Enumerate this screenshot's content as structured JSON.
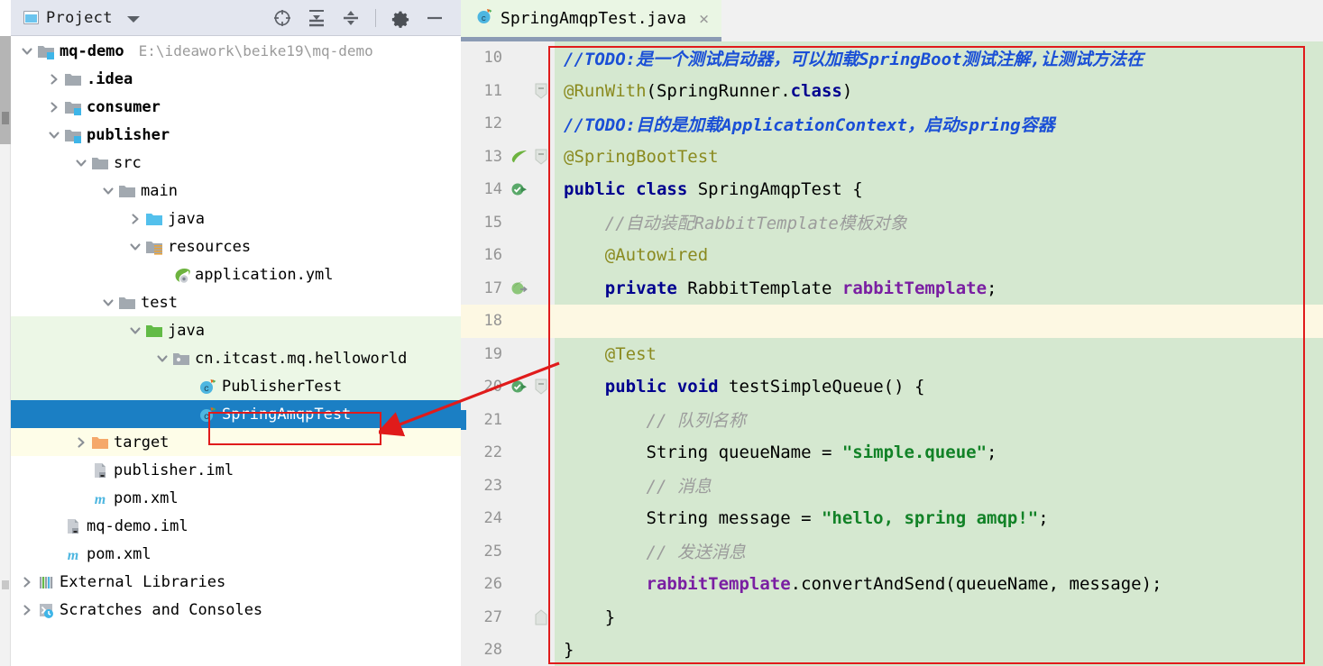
{
  "tool_window": {
    "title": "Project",
    "icons": [
      {
        "name": "locate-icon",
        "glyph": "crosshair"
      },
      {
        "name": "expand-all-icon",
        "glyph": "expand"
      },
      {
        "name": "collapse-all-icon",
        "glyph": "collapse"
      },
      {
        "name": "settings-gear-icon",
        "glyph": "gear"
      },
      {
        "name": "minimize-icon",
        "glyph": "minus"
      }
    ]
  },
  "tree": [
    {
      "label": "mq-demo",
      "path": "E:\\ideawork\\beike19\\mq-demo",
      "indent": 0,
      "arrow": "down",
      "icon": "module-folder",
      "bold": true,
      "bg": "none",
      "selected": false
    },
    {
      "label": ".idea",
      "path": "",
      "indent": 1,
      "arrow": "right",
      "icon": "folder-grey",
      "bold": true,
      "bg": "none",
      "selected": false
    },
    {
      "label": "consumer",
      "path": "",
      "indent": 1,
      "arrow": "right",
      "icon": "module-folder",
      "bold": true,
      "bg": "none",
      "selected": false
    },
    {
      "label": "publisher",
      "path": "",
      "indent": 1,
      "arrow": "down",
      "icon": "module-folder",
      "bold": true,
      "bg": "none",
      "selected": false
    },
    {
      "label": "src",
      "path": "",
      "indent": 2,
      "arrow": "down",
      "icon": "folder-grey",
      "bold": false,
      "bg": "none",
      "selected": false
    },
    {
      "label": "main",
      "path": "",
      "indent": 3,
      "arrow": "down",
      "icon": "folder-grey",
      "bold": false,
      "bg": "none",
      "selected": false
    },
    {
      "label": "java",
      "path": "",
      "indent": 4,
      "arrow": "right",
      "icon": "folder-blue",
      "bold": false,
      "bg": "none",
      "selected": false
    },
    {
      "label": "resources",
      "path": "",
      "indent": 4,
      "arrow": "down",
      "icon": "folder-resources",
      "bold": false,
      "bg": "none",
      "selected": false
    },
    {
      "label": "application.yml",
      "path": "",
      "indent": 5,
      "arrow": "none",
      "icon": "spring-yml",
      "bold": false,
      "bg": "none",
      "selected": false
    },
    {
      "label": "test",
      "path": "",
      "indent": 3,
      "arrow": "down",
      "icon": "folder-grey",
      "bold": false,
      "bg": "none",
      "selected": false
    },
    {
      "label": "java",
      "path": "",
      "indent": 4,
      "arrow": "down",
      "icon": "folder-green",
      "bold": false,
      "bg": "green",
      "selected": false
    },
    {
      "label": "cn.itcast.mq.helloworld",
      "path": "",
      "indent": 5,
      "arrow": "down",
      "icon": "package",
      "bold": false,
      "bg": "green",
      "selected": false
    },
    {
      "label": "PublisherTest",
      "path": "",
      "indent": 6,
      "arrow": "none",
      "icon": "class-test",
      "bold": false,
      "bg": "green",
      "selected": false
    },
    {
      "label": "SpringAmqpTest",
      "path": "",
      "indent": 6,
      "arrow": "none",
      "icon": "class-test",
      "bold": false,
      "bg": "none",
      "selected": true
    },
    {
      "label": "target",
      "path": "",
      "indent": 2,
      "arrow": "right",
      "icon": "folder-orange",
      "bold": false,
      "bg": "cream",
      "selected": false
    },
    {
      "label": "publisher.iml",
      "path": "",
      "indent": 2,
      "arrow": "none",
      "icon": "iml",
      "bold": false,
      "bg": "none",
      "selected": false
    },
    {
      "label": "pom.xml",
      "path": "",
      "indent": 2,
      "arrow": "none",
      "icon": "maven",
      "bold": false,
      "bg": "none",
      "selected": false
    },
    {
      "label": "mq-demo.iml",
      "path": "",
      "indent": 1,
      "arrow": "none",
      "icon": "iml",
      "bold": false,
      "bg": "none",
      "selected": false
    },
    {
      "label": "pom.xml",
      "path": "",
      "indent": 1,
      "arrow": "none",
      "icon": "maven",
      "bold": false,
      "bg": "none",
      "selected": false
    },
    {
      "label": "External Libraries",
      "path": "",
      "indent": 0,
      "arrow": "right",
      "icon": "libraries",
      "bold": false,
      "bg": "none",
      "selected": false
    },
    {
      "label": "Scratches and Consoles",
      "path": "",
      "indent": 0,
      "arrow": "right",
      "icon": "scratches",
      "bold": false,
      "bg": "none",
      "selected": false
    }
  ],
  "editor": {
    "tab": {
      "label": "SpringAmqpTest.java",
      "close": "×",
      "icon": "class-test-icon"
    },
    "caret_line": 18,
    "lines": [
      {
        "num": "10",
        "gutter_icon": "",
        "fold": "",
        "tokens": [
          {
            "t": "//TODO:是一个测试启动器，可以加载SpringBoot测试注解,让测试方法在",
            "c": "tk-todo"
          }
        ]
      },
      {
        "num": "11",
        "gutter_icon": "",
        "fold": "fold-open",
        "tokens": [
          {
            "t": "@RunWith",
            "c": "tk-anno"
          },
          {
            "t": "(SpringRunner.",
            "c": "tk-plain"
          },
          {
            "t": "class",
            "c": "tk-kw"
          },
          {
            "t": ")",
            "c": "tk-plain"
          }
        ]
      },
      {
        "num": "12",
        "gutter_icon": "",
        "fold": "",
        "tokens": [
          {
            "t": "//TODO:目的是加载ApplicationContext，启动spring容器",
            "c": "tk-todo"
          }
        ]
      },
      {
        "num": "13",
        "gutter_icon": "spring-leaf",
        "fold": "fold-open",
        "tokens": [
          {
            "t": "@SpringBootTest",
            "c": "tk-anno"
          }
        ]
      },
      {
        "num": "14",
        "gutter_icon": "run-test",
        "fold": "",
        "tokens": [
          {
            "t": "public class",
            "c": "tk-kw"
          },
          {
            "t": " SpringAmqpTest {",
            "c": "tk-plain"
          }
        ]
      },
      {
        "num": "15",
        "gutter_icon": "",
        "fold": "",
        "tokens": [
          {
            "t": "    //自动装配RabbitTemplate模板对象",
            "c": "tk-comment"
          }
        ]
      },
      {
        "num": "16",
        "gutter_icon": "",
        "fold": "",
        "tokens": [
          {
            "t": "    @Autowired",
            "c": "tk-anno"
          }
        ]
      },
      {
        "num": "17",
        "gutter_icon": "bean-nav",
        "fold": "",
        "tokens": [
          {
            "t": "    ",
            "c": "tk-plain"
          },
          {
            "t": "private",
            "c": "tk-kw"
          },
          {
            "t": " RabbitTemplate ",
            "c": "tk-plain"
          },
          {
            "t": "rabbitTemplate",
            "c": "tk-field"
          },
          {
            "t": ";",
            "c": "tk-plain"
          }
        ]
      },
      {
        "num": "18",
        "gutter_icon": "",
        "fold": "",
        "tokens": []
      },
      {
        "num": "19",
        "gutter_icon": "",
        "fold": "",
        "tokens": [
          {
            "t": "    @Test",
            "c": "tk-anno"
          }
        ]
      },
      {
        "num": "20",
        "gutter_icon": "run-test",
        "fold": "fold-open",
        "tokens": [
          {
            "t": "    ",
            "c": "tk-plain"
          },
          {
            "t": "public void",
            "c": "tk-kw"
          },
          {
            "t": " testSimpleQueue() {",
            "c": "tk-plain"
          }
        ]
      },
      {
        "num": "21",
        "gutter_icon": "",
        "fold": "",
        "tokens": [
          {
            "t": "        // 队列名称",
            "c": "tk-comment"
          }
        ]
      },
      {
        "num": "22",
        "gutter_icon": "",
        "fold": "",
        "tokens": [
          {
            "t": "        String queueName = ",
            "c": "tk-plain"
          },
          {
            "t": "\"simple.queue\"",
            "c": "tk-str"
          },
          {
            "t": ";",
            "c": "tk-plain"
          }
        ]
      },
      {
        "num": "23",
        "gutter_icon": "",
        "fold": "",
        "tokens": [
          {
            "t": "        // 消息",
            "c": "tk-comment"
          }
        ]
      },
      {
        "num": "24",
        "gutter_icon": "",
        "fold": "",
        "tokens": [
          {
            "t": "        String message = ",
            "c": "tk-plain"
          },
          {
            "t": "\"hello, spring amqp!\"",
            "c": "tk-str"
          },
          {
            "t": ";",
            "c": "tk-plain"
          }
        ]
      },
      {
        "num": "25",
        "gutter_icon": "",
        "fold": "",
        "tokens": [
          {
            "t": "        // 发送消息",
            "c": "tk-comment"
          }
        ]
      },
      {
        "num": "26",
        "gutter_icon": "",
        "fold": "",
        "tokens": [
          {
            "t": "        ",
            "c": "tk-plain"
          },
          {
            "t": "rabbitTemplate",
            "c": "tk-field"
          },
          {
            "t": ".convertAndSend(queueName, message);",
            "c": "tk-plain"
          }
        ]
      },
      {
        "num": "27",
        "gutter_icon": "",
        "fold": "fold-end",
        "tokens": [
          {
            "t": "    }",
            "c": "tk-plain"
          }
        ]
      },
      {
        "num": "28",
        "gutter_icon": "",
        "fold": "",
        "tokens": [
          {
            "t": "}",
            "c": "tk-plain"
          }
        ]
      }
    ]
  },
  "annotations": {
    "code_box_color": "#e01b1b",
    "tree_box_color": "#e01b1b",
    "arrow_color": "#e01b1b"
  }
}
